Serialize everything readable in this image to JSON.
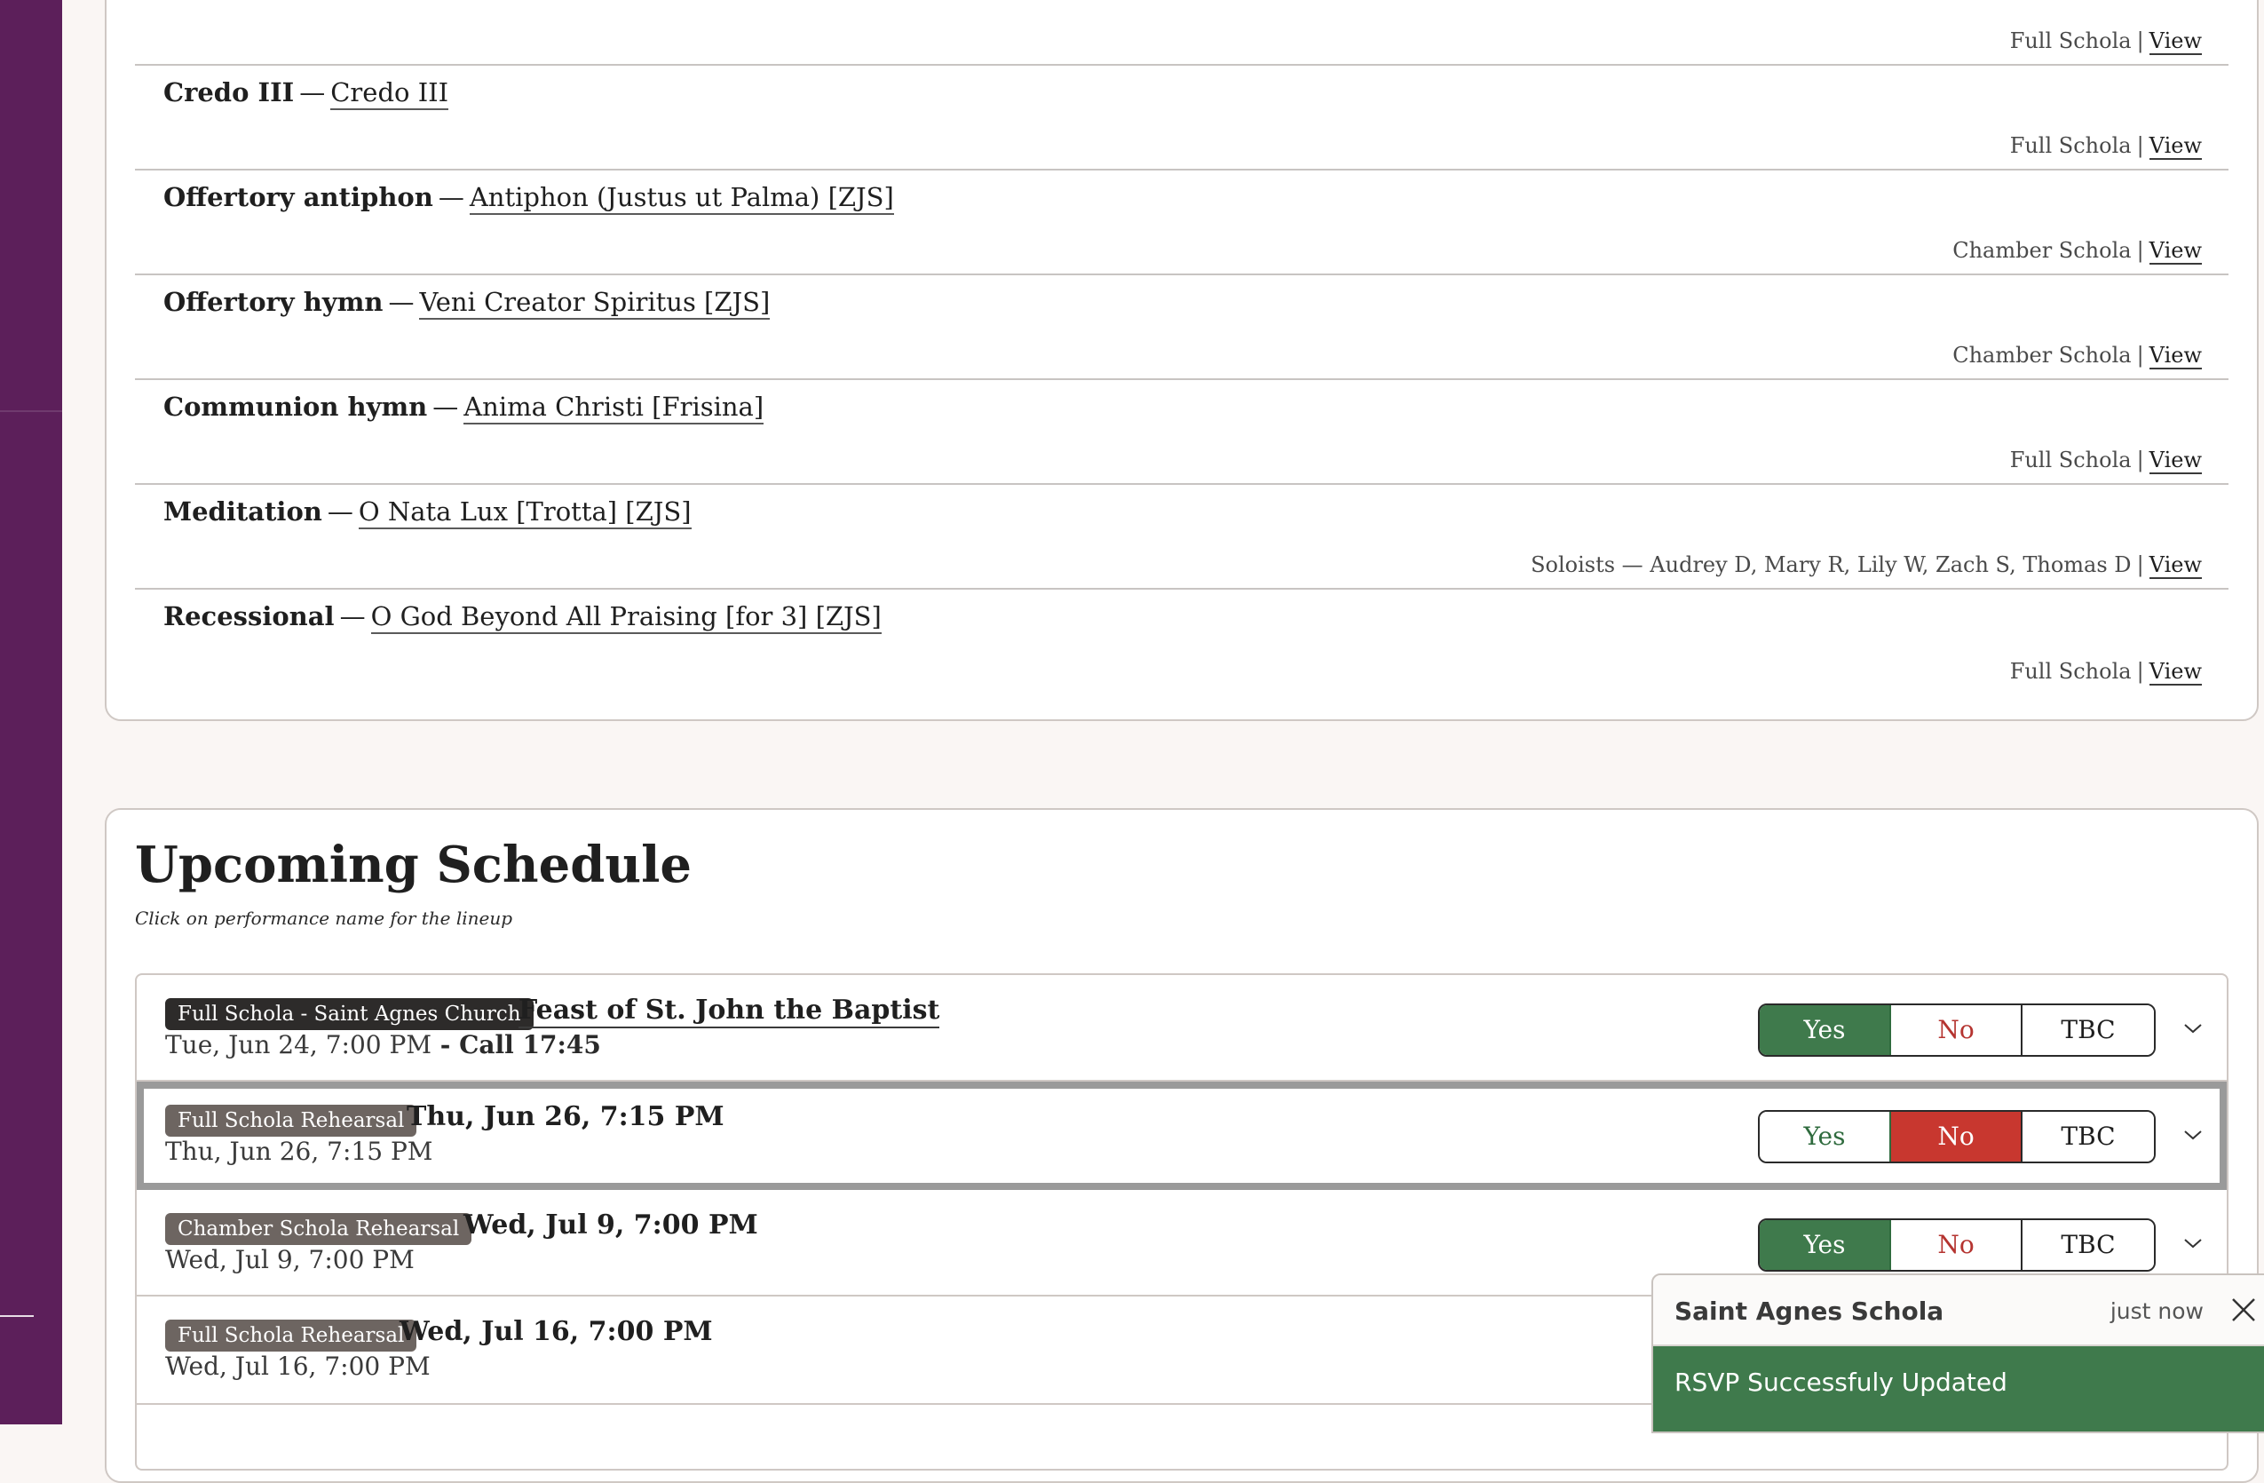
{
  "program": {
    "rows": [
      {
        "section": "",
        "piece": "",
        "ensemble": "Full Schola",
        "view_label": "View"
      },
      {
        "section": "Credo III",
        "piece": "Credo III",
        "ensemble": "Full Schola",
        "view_label": "View"
      },
      {
        "section": "Offertory antiphon",
        "piece": "Antiphon (Justus ut Palma) [ZJS]",
        "ensemble": "Chamber Schola",
        "view_label": "View"
      },
      {
        "section": "Offertory hymn",
        "piece": "Veni Creator Spiritus [ZJS]",
        "ensemble": "Chamber Schola",
        "view_label": "View"
      },
      {
        "section": "Communion hymn",
        "piece": "Anima Christi [Frisina]",
        "ensemble": "Full Schola",
        "view_label": "View"
      },
      {
        "section": "Meditation",
        "piece": "O Nata Lux [Trotta] [ZJS]",
        "ensemble": "Soloists — Audrey D, Mary R, Lily W, Zach S, Thomas D",
        "view_label": "View"
      },
      {
        "section": "Recessional",
        "piece": "O God Beyond All Praising [for 3] [ZJS]",
        "ensemble": "Full Schola",
        "view_label": "View"
      }
    ],
    "dash": "—",
    "separator": "|"
  },
  "schedule": {
    "heading": "Upcoming Schedule",
    "subtitle": "Click on performance name for the lineup",
    "events": [
      {
        "badge": "Full Schola - Saint Agnes Church",
        "title": "Feast of St. John the Baptist",
        "date": "Tue, Jun 24, 7:00 PM",
        "call": " - Call 17:45",
        "rsvp": "yes"
      },
      {
        "badge": "Full Schola Rehearsal",
        "title": "Thu, Jun 26, 7:15 PM",
        "date": "Thu, Jun 26, 7:15 PM",
        "call": "",
        "rsvp": "no"
      },
      {
        "badge": "Chamber Schola Rehearsal",
        "title": "Wed, Jul 9, 7:00 PM",
        "date": "Wed, Jul 9, 7:00 PM",
        "call": "",
        "rsvp": "yes"
      },
      {
        "badge": "Full Schola Rehearsal",
        "title": "Wed, Jul 16, 7:00 PM",
        "date": "Wed, Jul 16, 7:00 PM",
        "call": "",
        "rsvp": ""
      }
    ],
    "rsvp_labels": {
      "yes": "Yes",
      "no": "No",
      "tbc": "TBC"
    }
  },
  "toast": {
    "app": "Saint Agnes Schola",
    "time": "just now",
    "message": "RSVP Successfuly Updated"
  },
  "colors": {
    "sidebar": "#5c1f5a",
    "yes_selected": "#3f7a4c",
    "no_selected": "#c8372f",
    "toast_body": "#3f7a4c"
  },
  "icons": {
    "chevron": "chevron-down-icon",
    "close": "close-icon"
  }
}
